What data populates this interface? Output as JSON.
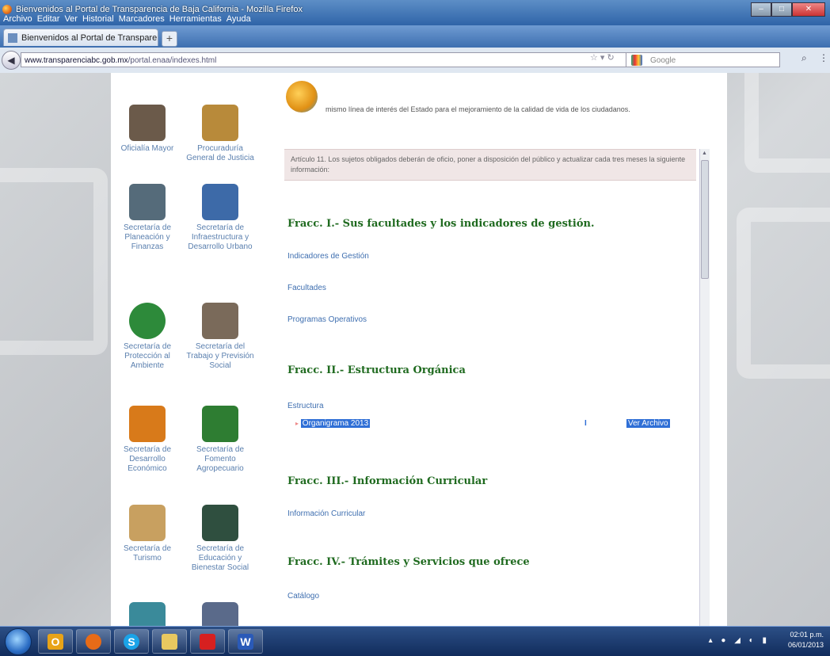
{
  "window": {
    "title": "Bienvenidos al Portal de Transparencia de Baja California - Mozilla Firefox",
    "controls": [
      "–",
      "□",
      "✕"
    ]
  },
  "menu": [
    "Archivo",
    "Editar",
    "Ver",
    "Historial",
    "Marcadores",
    "Herramientas",
    "Ayuda"
  ],
  "tab": {
    "label": "Bienvenidos al Portal de Transparencia d...",
    "new_tab": "+"
  },
  "nav": {
    "back": "◀",
    "url_host": "www.transparenciabc.gob.mx",
    "url_path": "/portal.enaa/indexes.html",
    "search_placeholder": "Google"
  },
  "sidebar": {
    "items": [
      {
        "label": "Oficialía Mayor",
        "color": "#6b5a4a"
      },
      {
        "label": "Procuraduría General de Justicia",
        "color": "#b88a3a"
      },
      {
        "label": "Secretaría de Planeación y Finanzas",
        "color": "#556b7a"
      },
      {
        "label": "Secretaría de Infraestructura y Desarrollo Urbano",
        "color": "#3d6aa8"
      },
      {
        "label": "Secretaría de Protección al Ambiente",
        "color": "#2d8a3a"
      },
      {
        "label": "Secretaría del Trabajo y Previsión Social",
        "color": "#7a6a5a"
      },
      {
        "label": "Secretaría de Desarrollo Económico",
        "color": "#d87a1a"
      },
      {
        "label": "Secretaría de Fomento Agropecuario",
        "color": "#2e7d32"
      },
      {
        "label": "Secretaría de Turismo",
        "color": "#c8a060"
      },
      {
        "label": "Secretaría de Educación y Bienestar Social",
        "color": "#2f4f3f"
      },
      {
        "label": "",
        "color": "#3a8a9a"
      },
      {
        "label": "",
        "color": "#5a6a8a"
      }
    ]
  },
  "content": {
    "intro": "mismo línea de interés del Estado para el mejoramiento de la calidad de vida de los ciudadanos.",
    "article": "Artículo 11. Los sujetos obligados deberán de oficio, poner a disposición del público y actualizar cada tres meses la siguiente información:",
    "sections": [
      {
        "heading": "Fracc. I.- Sus facultades y los indicadores de gestión.",
        "links": [
          "Indicadores de Gestión",
          "Facultades",
          "Programas Operativos"
        ]
      },
      {
        "heading": "Fracc. II.- Estructura Orgánica",
        "links": [
          "Estructura"
        ],
        "sub_item": "Organigrama 2013",
        "sub_marker": "I",
        "action": "Ver Archivo"
      },
      {
        "heading": "Fracc. III.- Información Curricular",
        "links": [
          "Información Curricular"
        ]
      },
      {
        "heading": "Fracc. IV.- Trámites y Servicios que ofrece",
        "links": [
          "Catálogo"
        ]
      }
    ]
  },
  "taskbar": {
    "apps": [
      {
        "name": "outlook",
        "glyph": "O",
        "color": "#e8a317"
      },
      {
        "name": "firefox",
        "glyph": "",
        "color": "#e76b17"
      },
      {
        "name": "skype",
        "glyph": "S",
        "color": "#1aa3e8"
      },
      {
        "name": "explorer",
        "glyph": "",
        "color": "#e8c860"
      },
      {
        "name": "acrobat",
        "glyph": "",
        "color": "#d62020"
      },
      {
        "name": "word",
        "glyph": "W",
        "color": "#2a5ab8"
      }
    ],
    "time": "02:01 p.m.",
    "date": "06/01/2013"
  }
}
